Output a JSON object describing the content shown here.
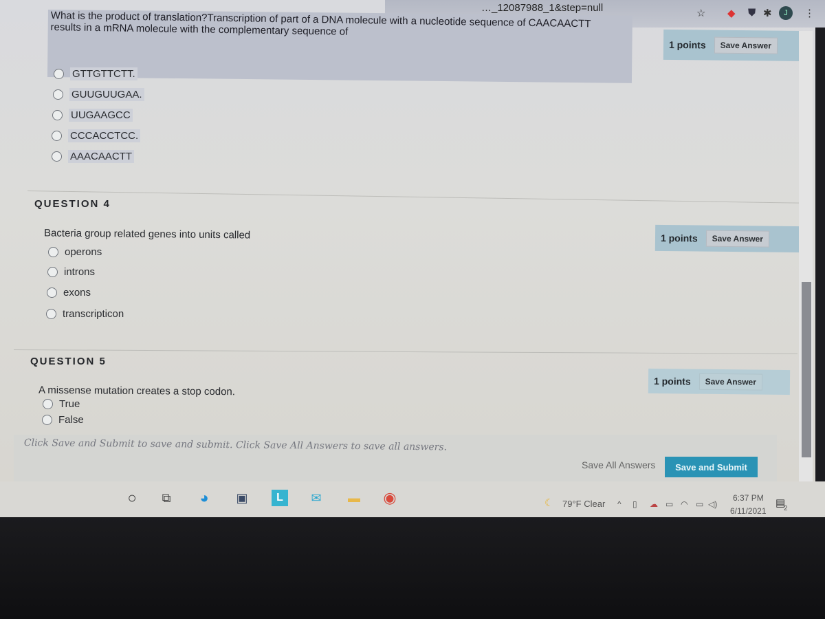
{
  "browser": {
    "url_fragment": "…_12087988_1&step=null",
    "icons": [
      "star-icon",
      "extension-red-icon",
      "shield-icon",
      "puzzle-icon",
      "profile-avatar",
      "menu-dots-icon"
    ],
    "avatar_initial": "J"
  },
  "questions": [
    {
      "heading": "",
      "text": "What is the product of translation?Transcription of part of a DNA molecule with a nucleotide sequence of CAACAACTT results in a mRNA molecule with the complementary sequence of",
      "points": "1 points",
      "save_label": "Save Answer",
      "options": [
        "GTTGTTCTT.",
        "GUUGUUGAA.",
        "UUGAAGCC",
        "CCCACCTCC.",
        "AAACAACTT"
      ]
    },
    {
      "heading": "QUESTION 4",
      "text": "Bacteria group related genes into units called",
      "points": "1 points",
      "save_label": "Save Answer",
      "options": [
        "operons",
        "introns",
        "exons",
        "transcripticon"
      ]
    },
    {
      "heading": "QUESTION 5",
      "text": "A missense mutation creates a stop codon.",
      "points": "1 points",
      "save_label": "Save Answer",
      "options": [
        "True",
        "False"
      ]
    }
  ],
  "footer": {
    "note": "Click Save and Submit to save and submit. Click Save All Answers to save all answers.",
    "save_all_label": "Save All Answers",
    "save_submit_label": "Save and Submit"
  },
  "taskbar": {
    "apps": [
      "search-circle-icon",
      "task-view-icon",
      "edge-icon",
      "store-icon",
      "l-app-icon",
      "mail-icon",
      "file-explorer-icon",
      "chrome-icon"
    ],
    "weather": "79°F  Clear",
    "time": "6:37 PM",
    "date": "6/11/2021",
    "notification_count": "2"
  },
  "colors": {
    "accent": "#2a93b5",
    "points_box": "#a9c3cf",
    "question_highlight": "#bcc0cc"
  }
}
